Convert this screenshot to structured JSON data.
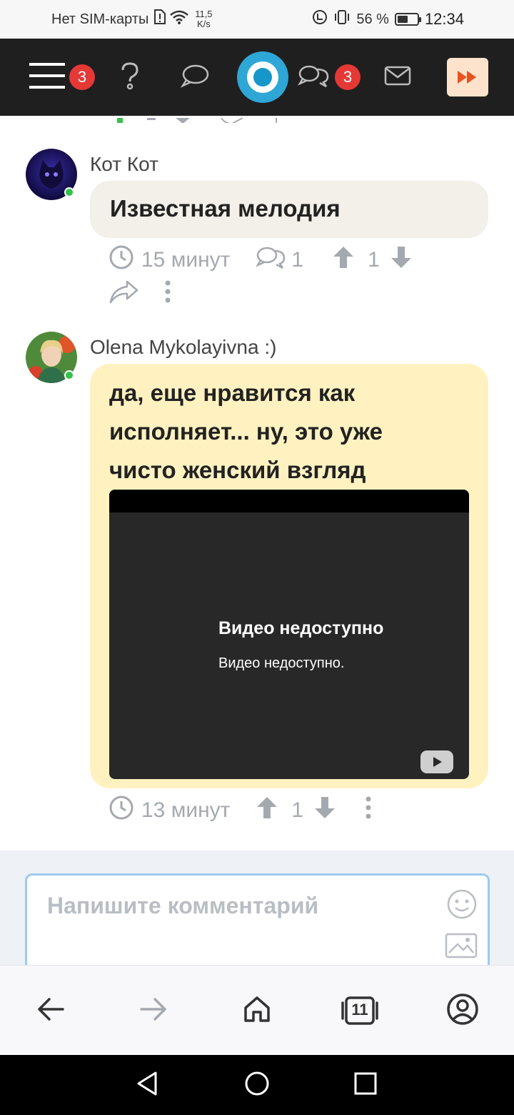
{
  "status_bar": {
    "carrier": "Нет SIM-карты",
    "speed_value": "11,5",
    "speed_unit": "K/s",
    "battery": "56 %",
    "battery_level": 0.56,
    "time": "12:34"
  },
  "header": {
    "menu_badge": "3",
    "messages_badge": "3",
    "icons": [
      "menu-icon",
      "help-icon",
      "chat-icon",
      "logo-icon",
      "messages-icon",
      "mail-icon",
      "fast-forward-icon"
    ]
  },
  "comments": [
    {
      "author": "Кот Кот",
      "text": "Известная мелодия",
      "time": "15 минут",
      "replies": "1",
      "votes": "1"
    },
    {
      "author": "Olena Mykolayivna :)",
      "text_lines": [
        "да, еще нравится как",
        "исполняет... ну, это уже",
        "чисто женский взгляд"
      ],
      "video_title": "Видео недоступно",
      "video_subtitle": "Видео недоступно.",
      "time": "13 минут",
      "votes": "1"
    }
  ],
  "composer": {
    "placeholder": "Напишите комментарий"
  },
  "browser_bar": {
    "tabs_count": "11"
  },
  "colors": {
    "header_bg": "#1f1f1f",
    "badge": "#e53935",
    "logo": "#2ea6d6",
    "bubble_1": "#f3efe9",
    "bubble_2": "#fff2c0",
    "online": "#33c14a"
  }
}
